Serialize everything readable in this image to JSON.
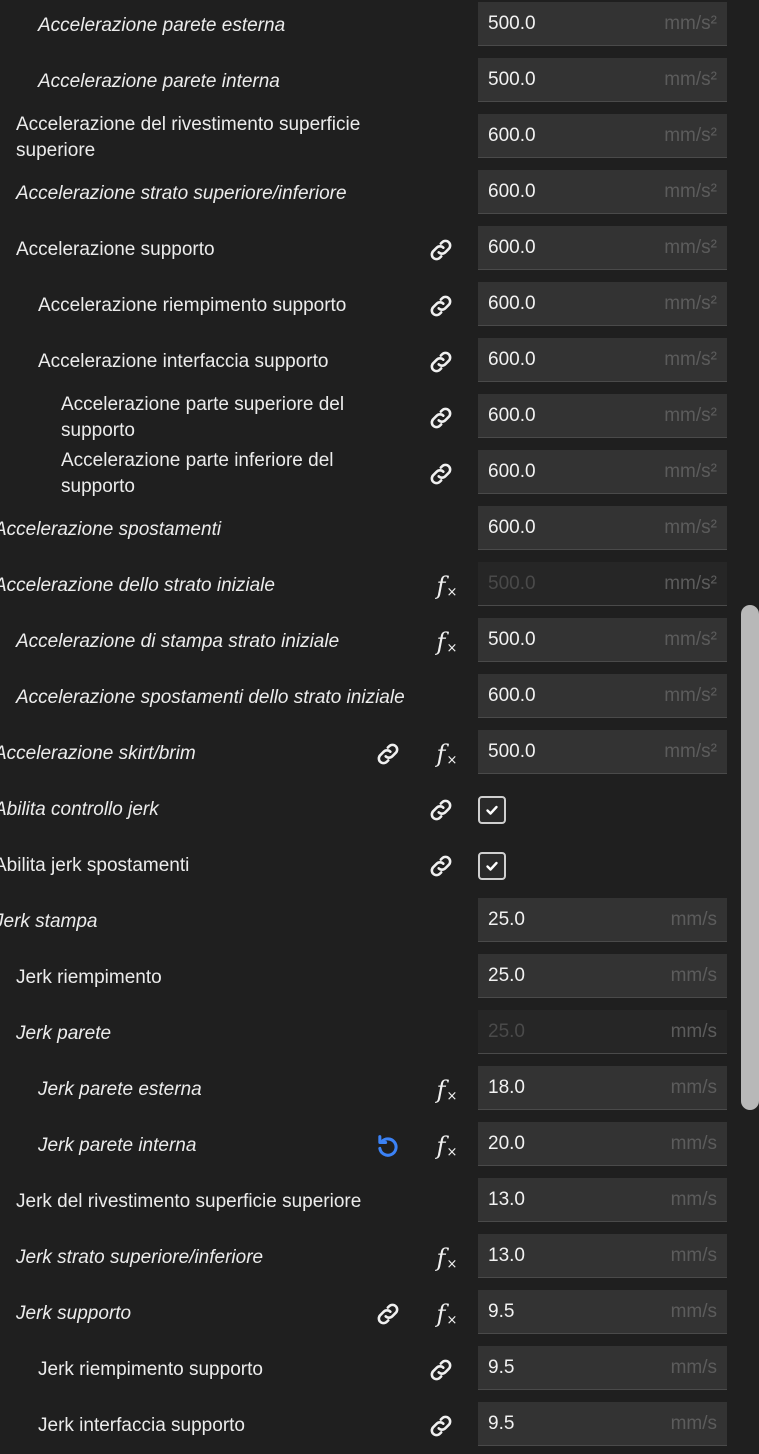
{
  "units": {
    "accel": "mm/s²",
    "jerk": "mm/s"
  },
  "colors": {
    "background": "#1f1f1f",
    "field": "#333333",
    "reset_blue": "#3b82f6"
  },
  "rows": [
    {
      "label": "Accelerazione parete esterna",
      "italic": true,
      "indent": 38,
      "value": "500.0",
      "unit": "mm/s²"
    },
    {
      "label": "Accelerazione parete interna",
      "italic": true,
      "indent": 38,
      "value": "500.0",
      "unit": "mm/s²"
    },
    {
      "label": "Accelerazione del rivestimento superficie\nsuperiore",
      "italic": false,
      "indent": 16,
      "value": "600.0",
      "unit": "mm/s²"
    },
    {
      "label": "Accelerazione strato superiore/inferiore",
      "italic": true,
      "indent": 16,
      "value": "600.0",
      "unit": "mm/s²"
    },
    {
      "label": "Accelerazione supporto",
      "italic": false,
      "indent": 16,
      "link": true,
      "value": "600.0",
      "unit": "mm/s²"
    },
    {
      "label": "Accelerazione riempimento supporto",
      "italic": false,
      "indent": 38,
      "link": true,
      "value": "600.0",
      "unit": "mm/s²"
    },
    {
      "label": "Accelerazione interfaccia supporto",
      "italic": false,
      "indent": 38,
      "link": true,
      "value": "600.0",
      "unit": "mm/s²"
    },
    {
      "label": "Accelerazione parte superiore del\nsupporto",
      "italic": false,
      "indent": 61,
      "link": true,
      "value": "600.0",
      "unit": "mm/s²"
    },
    {
      "label": "Accelerazione parte inferiore del\nsupporto",
      "italic": false,
      "indent": 61,
      "link": true,
      "value": "600.0",
      "unit": "mm/s²"
    },
    {
      "label": "Accelerazione spostamenti",
      "italic": true,
      "indent": -6,
      "value": "600.0",
      "unit": "mm/s²"
    },
    {
      "label": "Accelerazione dello strato iniziale",
      "italic": true,
      "indent": -6,
      "fx": true,
      "disabled": true,
      "value": "500.0",
      "unit": "mm/s²"
    },
    {
      "label": "Accelerazione di stampa strato iniziale",
      "italic": true,
      "indent": 16,
      "fx": true,
      "value": "500.0",
      "unit": "mm/s²"
    },
    {
      "label": "Accelerazione spostamenti dello strato iniziale",
      "italic": true,
      "indent": 16,
      "value": "600.0",
      "unit": "mm/s²"
    },
    {
      "label": "Accelerazione skirt/brim",
      "italic": true,
      "indent": -6,
      "link2": true,
      "fx": true,
      "value": "500.0",
      "unit": "mm/s²"
    },
    {
      "label": "Abilita controllo jerk",
      "italic": true,
      "indent": -6,
      "link": true,
      "checkbox": true
    },
    {
      "label": "Abilita jerk spostamenti",
      "italic": false,
      "indent": -6,
      "link": true,
      "checkbox": true
    },
    {
      "label": "Jerk stampa",
      "italic": true,
      "indent": -6,
      "value": "25.0",
      "unit": "mm/s"
    },
    {
      "label": "Jerk riempimento",
      "italic": false,
      "indent": 16,
      "value": "25.0",
      "unit": "mm/s"
    },
    {
      "label": "Jerk parete",
      "italic": true,
      "indent": 16,
      "disabled": true,
      "value": "25.0",
      "unit": "mm/s"
    },
    {
      "label": "Jerk parete esterna",
      "italic": true,
      "indent": 38,
      "fx": true,
      "value": "18.0",
      "unit": "mm/s"
    },
    {
      "label": "Jerk parete interna",
      "italic": true,
      "indent": 38,
      "reset": true,
      "fx": true,
      "value": "20.0",
      "unit": "mm/s"
    },
    {
      "label": "Jerk del rivestimento superficie superiore",
      "italic": false,
      "indent": 16,
      "value": "13.0",
      "unit": "mm/s"
    },
    {
      "label": "Jerk strato superiore/inferiore",
      "italic": true,
      "indent": 16,
      "fx": true,
      "value": "13.0",
      "unit": "mm/s"
    },
    {
      "label": "Jerk supporto",
      "italic": true,
      "indent": 16,
      "link2": true,
      "fx": true,
      "value": "9.5",
      "unit": "mm/s"
    },
    {
      "label": "Jerk riempimento supporto",
      "italic": false,
      "indent": 38,
      "link": true,
      "value": "9.5",
      "unit": "mm/s"
    },
    {
      "label": "Jerk interfaccia supporto",
      "italic": false,
      "indent": 38,
      "link": true,
      "value": "9.5",
      "unit": "mm/s"
    }
  ]
}
